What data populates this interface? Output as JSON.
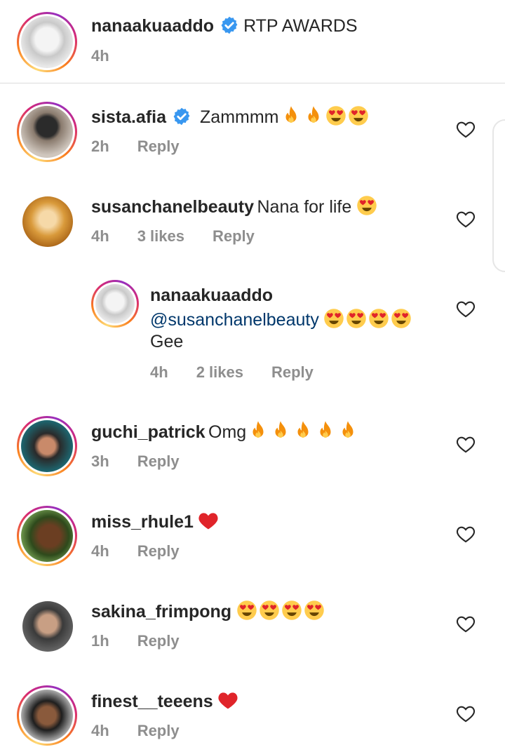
{
  "caption": {
    "username": "nanaakuaaddo",
    "verified": true,
    "text": "RTP AWARDS",
    "time": "4h"
  },
  "comments": [
    {
      "username": "sista.afia",
      "verified": true,
      "text": "Zammmm",
      "emojis": [
        "fire",
        "fire",
        "heart-eyes",
        "heart-eyes"
      ],
      "time": "2h",
      "likes": "",
      "reply": "Reply"
    },
    {
      "username": "susanchanelbeauty",
      "verified": false,
      "text": "Nana for life",
      "emojis": [
        "heart-eyes"
      ],
      "time": "4h",
      "likes": "3 likes",
      "reply": "Reply"
    },
    {
      "username": "nanaakuaaddo",
      "verified": false,
      "mention": "@susanchanelbeauty",
      "text2": "Gee",
      "emojis": [
        "heart-eyes",
        "heart-eyes",
        "heart-eyes",
        "heart-eyes"
      ],
      "time": "4h",
      "likes": "2 likes",
      "reply": "Reply"
    },
    {
      "username": "guchi_patrick",
      "verified": false,
      "text": "Omg",
      "emojis": [
        "fire",
        "fire",
        "fire",
        "fire",
        "fire"
      ],
      "time": "3h",
      "likes": "",
      "reply": "Reply"
    },
    {
      "username": "miss_rhule1",
      "verified": false,
      "text": "",
      "emojis": [
        "red-heart"
      ],
      "time": "4h",
      "likes": "",
      "reply": "Reply"
    },
    {
      "username": "sakina_frimpong",
      "verified": false,
      "text": "",
      "emojis": [
        "heart-eyes",
        "heart-eyes",
        "heart-eyes",
        "heart-eyes"
      ],
      "time": "1h",
      "likes": "",
      "reply": "Reply"
    },
    {
      "username": "finest__teeens",
      "verified": false,
      "text": "",
      "emojis": [
        "red-heart"
      ],
      "time": "4h",
      "likes": "",
      "reply": "Reply"
    }
  ],
  "colors": {
    "verified": "#3897f0",
    "meta": "#8e8e8e",
    "mention": "#00376b",
    "heart_red": "#e0242a"
  }
}
